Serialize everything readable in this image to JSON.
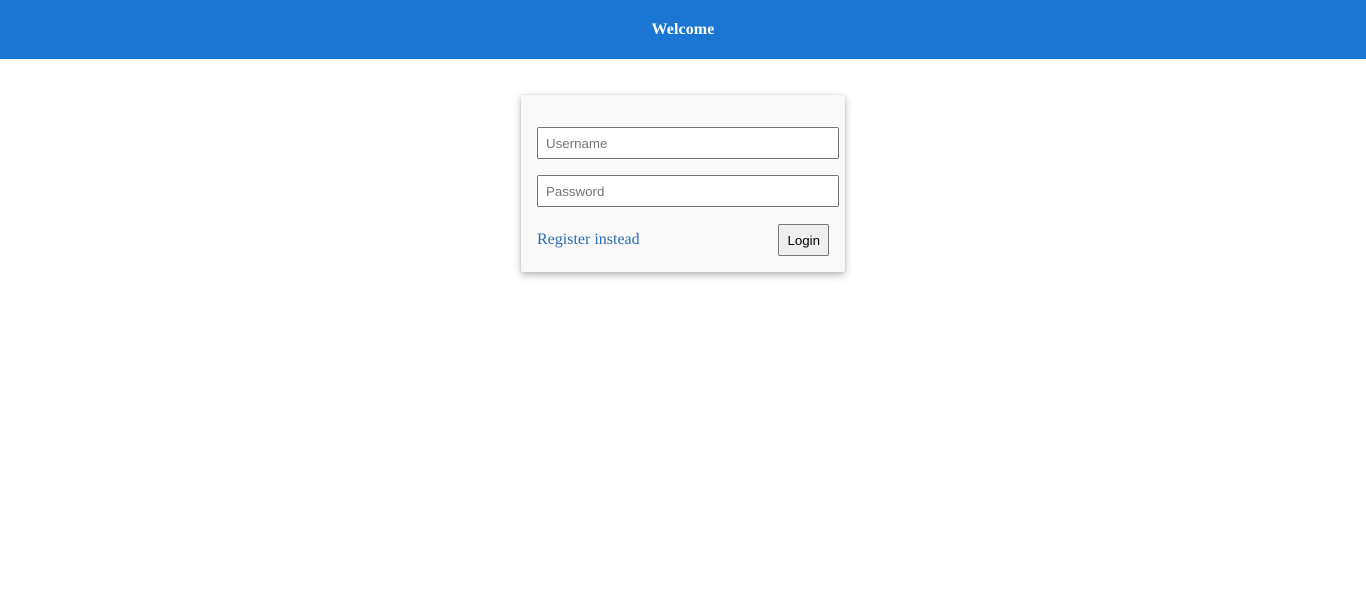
{
  "header": {
    "title": "Welcome",
    "background_color": "#1976d2"
  },
  "login_form": {
    "username": {
      "placeholder": "Username",
      "value": ""
    },
    "password": {
      "placeholder": "Password",
      "value": ""
    },
    "register_link_label": "Register instead",
    "login_button_label": "Login"
  },
  "colors": {
    "link": "#2a6bb3",
    "card_background": "#f9f9f9"
  }
}
